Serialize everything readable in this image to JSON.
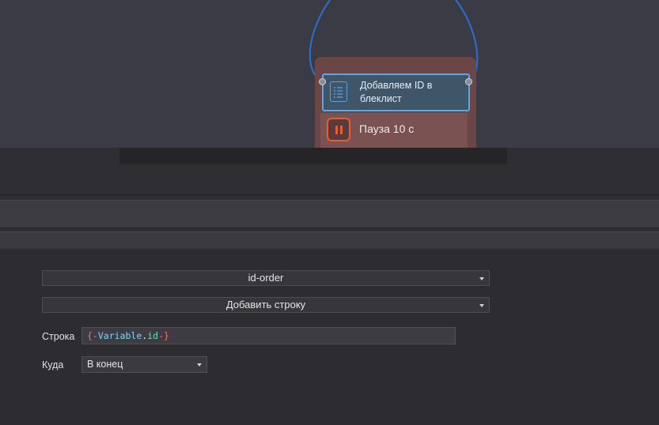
{
  "canvas": {
    "nodes": [
      {
        "label": "Добавляем ID в блеклист",
        "icon": "list-icon",
        "color": "#58a8e8"
      },
      {
        "label": "Пауза 10 с",
        "icon": "pause-icon",
        "color": "#e85d2e"
      }
    ],
    "group_color": "#6b4646",
    "wire_color": "#2a6fd0"
  },
  "properties": {
    "variable_select": {
      "value": "id-order"
    },
    "action_select": {
      "value": "Добавить строку"
    },
    "string_field": {
      "label": "Строка",
      "value": "{-Variable.id-}",
      "tokens": {
        "open": "{-",
        "var": "Variable",
        "dot": ".",
        "field": "id",
        "close": "-}"
      }
    },
    "position_field": {
      "label": "Куда",
      "value": "В конец"
    }
  }
}
